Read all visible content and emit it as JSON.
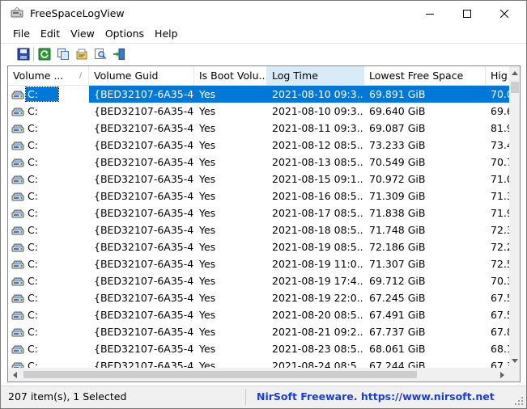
{
  "window": {
    "title": "FreeSpaceLogView"
  },
  "menu": [
    "File",
    "Edit",
    "View",
    "Options",
    "Help"
  ],
  "toolbar": {
    "icons": [
      "save-icon",
      "refresh-icon",
      "copy-icon",
      "properties-icon",
      "find-icon",
      "exit-icon"
    ]
  },
  "columns": [
    {
      "label": "Volume ...",
      "sorted": true
    },
    {
      "label": "Volume Guid"
    },
    {
      "label": "Is Boot Volu..."
    },
    {
      "label": "Log Time",
      "hot": true
    },
    {
      "label": "Lowest Free Space"
    },
    {
      "label": "Hig"
    }
  ],
  "rows": [
    {
      "volume": "C:",
      "guid": "{BED32107-6A35-4...",
      "boot": "Yes",
      "time": "2021-08-10 09:3...",
      "lowest": "69.891 GiB",
      "high": "70.0",
      "selected": true
    },
    {
      "volume": "C:",
      "guid": "{BED32107-6A35-4...",
      "boot": "Yes",
      "time": "2021-08-10 09:3...",
      "lowest": "69.640 GiB",
      "high": "69.6"
    },
    {
      "volume": "C:",
      "guid": "{BED32107-6A35-4...",
      "boot": "Yes",
      "time": "2021-08-11 09:3...",
      "lowest": "69.087 GiB",
      "high": "81.9"
    },
    {
      "volume": "C:",
      "guid": "{BED32107-6A35-4...",
      "boot": "Yes",
      "time": "2021-08-12 08:5...",
      "lowest": "73.233 GiB",
      "high": "73.4"
    },
    {
      "volume": "C:",
      "guid": "{BED32107-6A35-4...",
      "boot": "Yes",
      "time": "2021-08-13 08:5...",
      "lowest": "70.549 GiB",
      "high": "70.7"
    },
    {
      "volume": "C:",
      "guid": "{BED32107-6A35-4...",
      "boot": "Yes",
      "time": "2021-08-15 09:1...",
      "lowest": "70.972 GiB",
      "high": "71.0"
    },
    {
      "volume": "C:",
      "guid": "{BED32107-6A35-4...",
      "boot": "Yes",
      "time": "2021-08-16 08:5...",
      "lowest": "71.309 GiB",
      "high": "71.3"
    },
    {
      "volume": "C:",
      "guid": "{BED32107-6A35-4...",
      "boot": "Yes",
      "time": "2021-08-17 08:5...",
      "lowest": "71.838 GiB",
      "high": "71.9"
    },
    {
      "volume": "C:",
      "guid": "{BED32107-6A35-4...",
      "boot": "Yes",
      "time": "2021-08-18 08:5...",
      "lowest": "71.748 GiB",
      "high": "72.3"
    },
    {
      "volume": "C:",
      "guid": "{BED32107-6A35-4...",
      "boot": "Yes",
      "time": "2021-08-19 08:5...",
      "lowest": "72.186 GiB",
      "high": "72.2"
    },
    {
      "volume": "C:",
      "guid": "{BED32107-6A35-4...",
      "boot": "Yes",
      "time": "2021-08-19 11:0...",
      "lowest": "71.307 GiB",
      "high": "72.5"
    },
    {
      "volume": "C:",
      "guid": "{BED32107-6A35-4...",
      "boot": "Yes",
      "time": "2021-08-19 17:4...",
      "lowest": "69.712 GiB",
      "high": "70.3"
    },
    {
      "volume": "C:",
      "guid": "{BED32107-6A35-4...",
      "boot": "Yes",
      "time": "2021-08-19 22:0...",
      "lowest": "67.245 GiB",
      "high": "67.5"
    },
    {
      "volume": "C:",
      "guid": "{BED32107-6A35-4...",
      "boot": "Yes",
      "time": "2021-08-20 08:5...",
      "lowest": "67.491 GiB",
      "high": "67.5"
    },
    {
      "volume": "C:",
      "guid": "{BED32107-6A35-4...",
      "boot": "Yes",
      "time": "2021-08-21 09:2...",
      "lowest": "67.737 GiB",
      "high": "67.8"
    },
    {
      "volume": "C:",
      "guid": "{BED32107-6A35-4...",
      "boot": "Yes",
      "time": "2021-08-23 08:5...",
      "lowest": "68.061 GiB",
      "high": "68.1"
    },
    {
      "volume": "C:",
      "guid": "{BED32107-6A35-4...",
      "boot": "Yes",
      "time": "2021-08-24 08:5...",
      "lowest": "67.244 GiB",
      "high": "67.3"
    }
  ],
  "status": {
    "items": "207 item(s), 1 Selected",
    "link": "NirSoft Freeware. https://www.nirsoft.net"
  },
  "colors": {
    "selection": "#0078d7",
    "sorted_header": "#d9ebf9",
    "link": "#1c3fcf"
  }
}
